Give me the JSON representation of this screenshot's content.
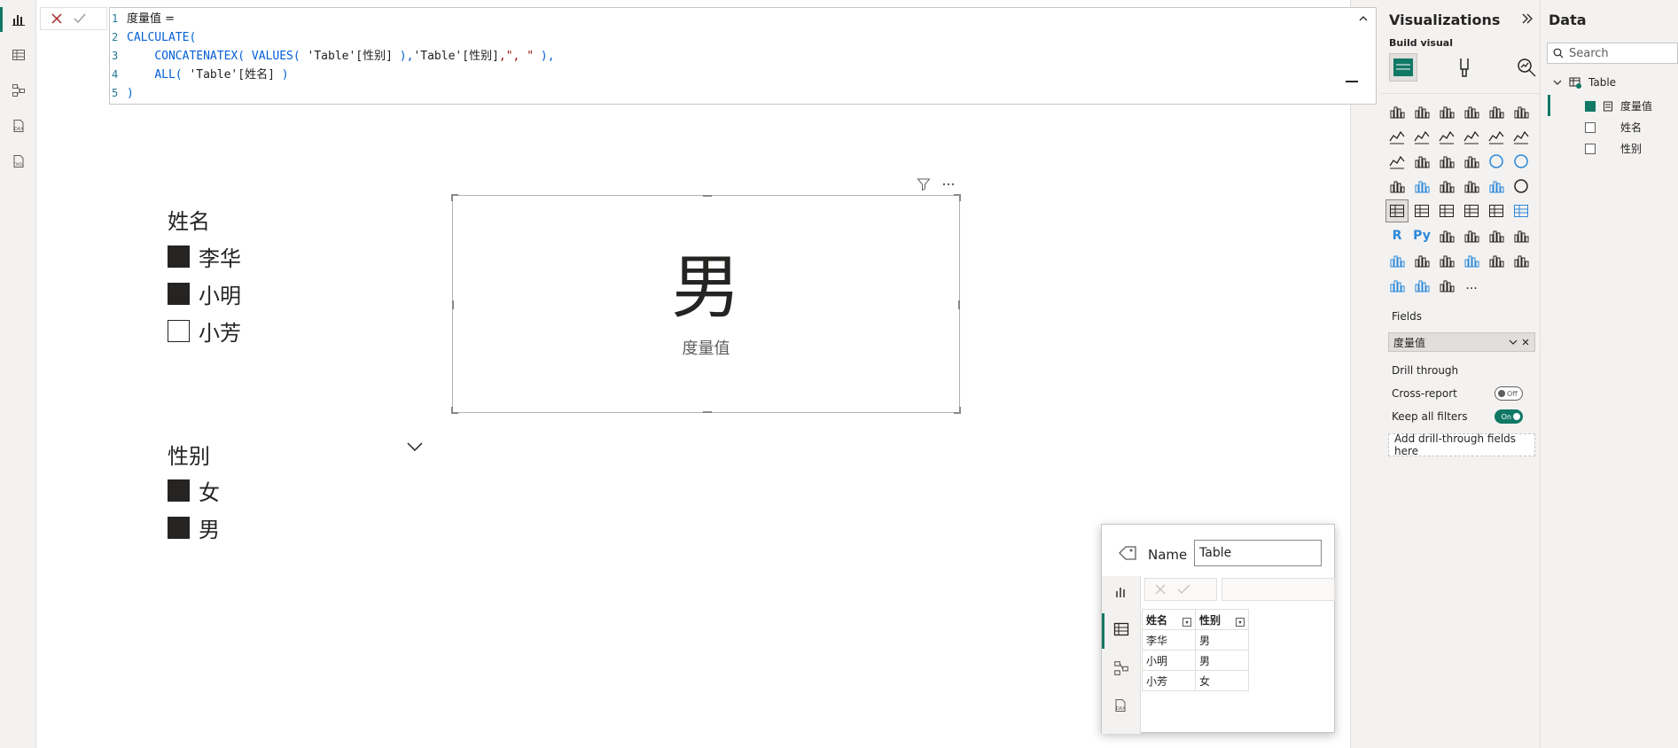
{
  "formula": {
    "lines": [
      {
        "num": "1",
        "text": "度量值 ="
      },
      {
        "num": "2",
        "text": "CALCULATE("
      },
      {
        "num": "3",
        "parts": [
          "CONCATENATEX(",
          " VALUES(",
          " 'Table'[性别]",
          " ),",
          "'Table'[性别]",
          ",\", \"",
          " ),"
        ]
      },
      {
        "num": "4",
        "parts": [
          "ALL(",
          " 'Table'[姓名]",
          " )"
        ]
      },
      {
        "num": "5",
        "text": ")"
      }
    ]
  },
  "slicer_name": {
    "title": "姓名",
    "items": [
      {
        "label": "李华",
        "checked": true
      },
      {
        "label": "小明",
        "checked": true
      },
      {
        "label": "小芳",
        "checked": false
      }
    ]
  },
  "slicer_gender": {
    "title": "性别",
    "items": [
      {
        "label": "女",
        "checked": true
      },
      {
        "label": "男",
        "checked": true
      }
    ]
  },
  "card": {
    "value": "男",
    "label": "度量值"
  },
  "viz_pane": {
    "title": "Visualizations",
    "build_visual": "Build visual",
    "fields_label": "Fields",
    "field_value": "度量值",
    "drill_through": "Drill through",
    "cross_report": "Cross-report",
    "cross_report_state": "Off",
    "keep_filters": "Keep all filters",
    "keep_filters_state": "On",
    "add_drill": "Add drill-through fields here",
    "r_label": "R",
    "py_label": "Py",
    "more": "..."
  },
  "data_pane": {
    "title": "Data",
    "search_placeholder": "Search",
    "table_name": "Table",
    "fields": [
      {
        "name": "度量值",
        "checked": true
      },
      {
        "name": "姓名",
        "checked": false
      },
      {
        "name": "性别",
        "checked": false
      }
    ]
  },
  "popup": {
    "name_label": "Name",
    "name_value": "Table",
    "headers": [
      "姓名",
      "性别"
    ],
    "rows": [
      [
        "李华",
        "男"
      ],
      [
        "小明",
        "男"
      ],
      [
        "小芳",
        "女"
      ]
    ]
  },
  "colors": {
    "accent": "#117865",
    "code_keyword": "#035fd6",
    "code_string": "#a31515",
    "line_number": "#237893"
  }
}
